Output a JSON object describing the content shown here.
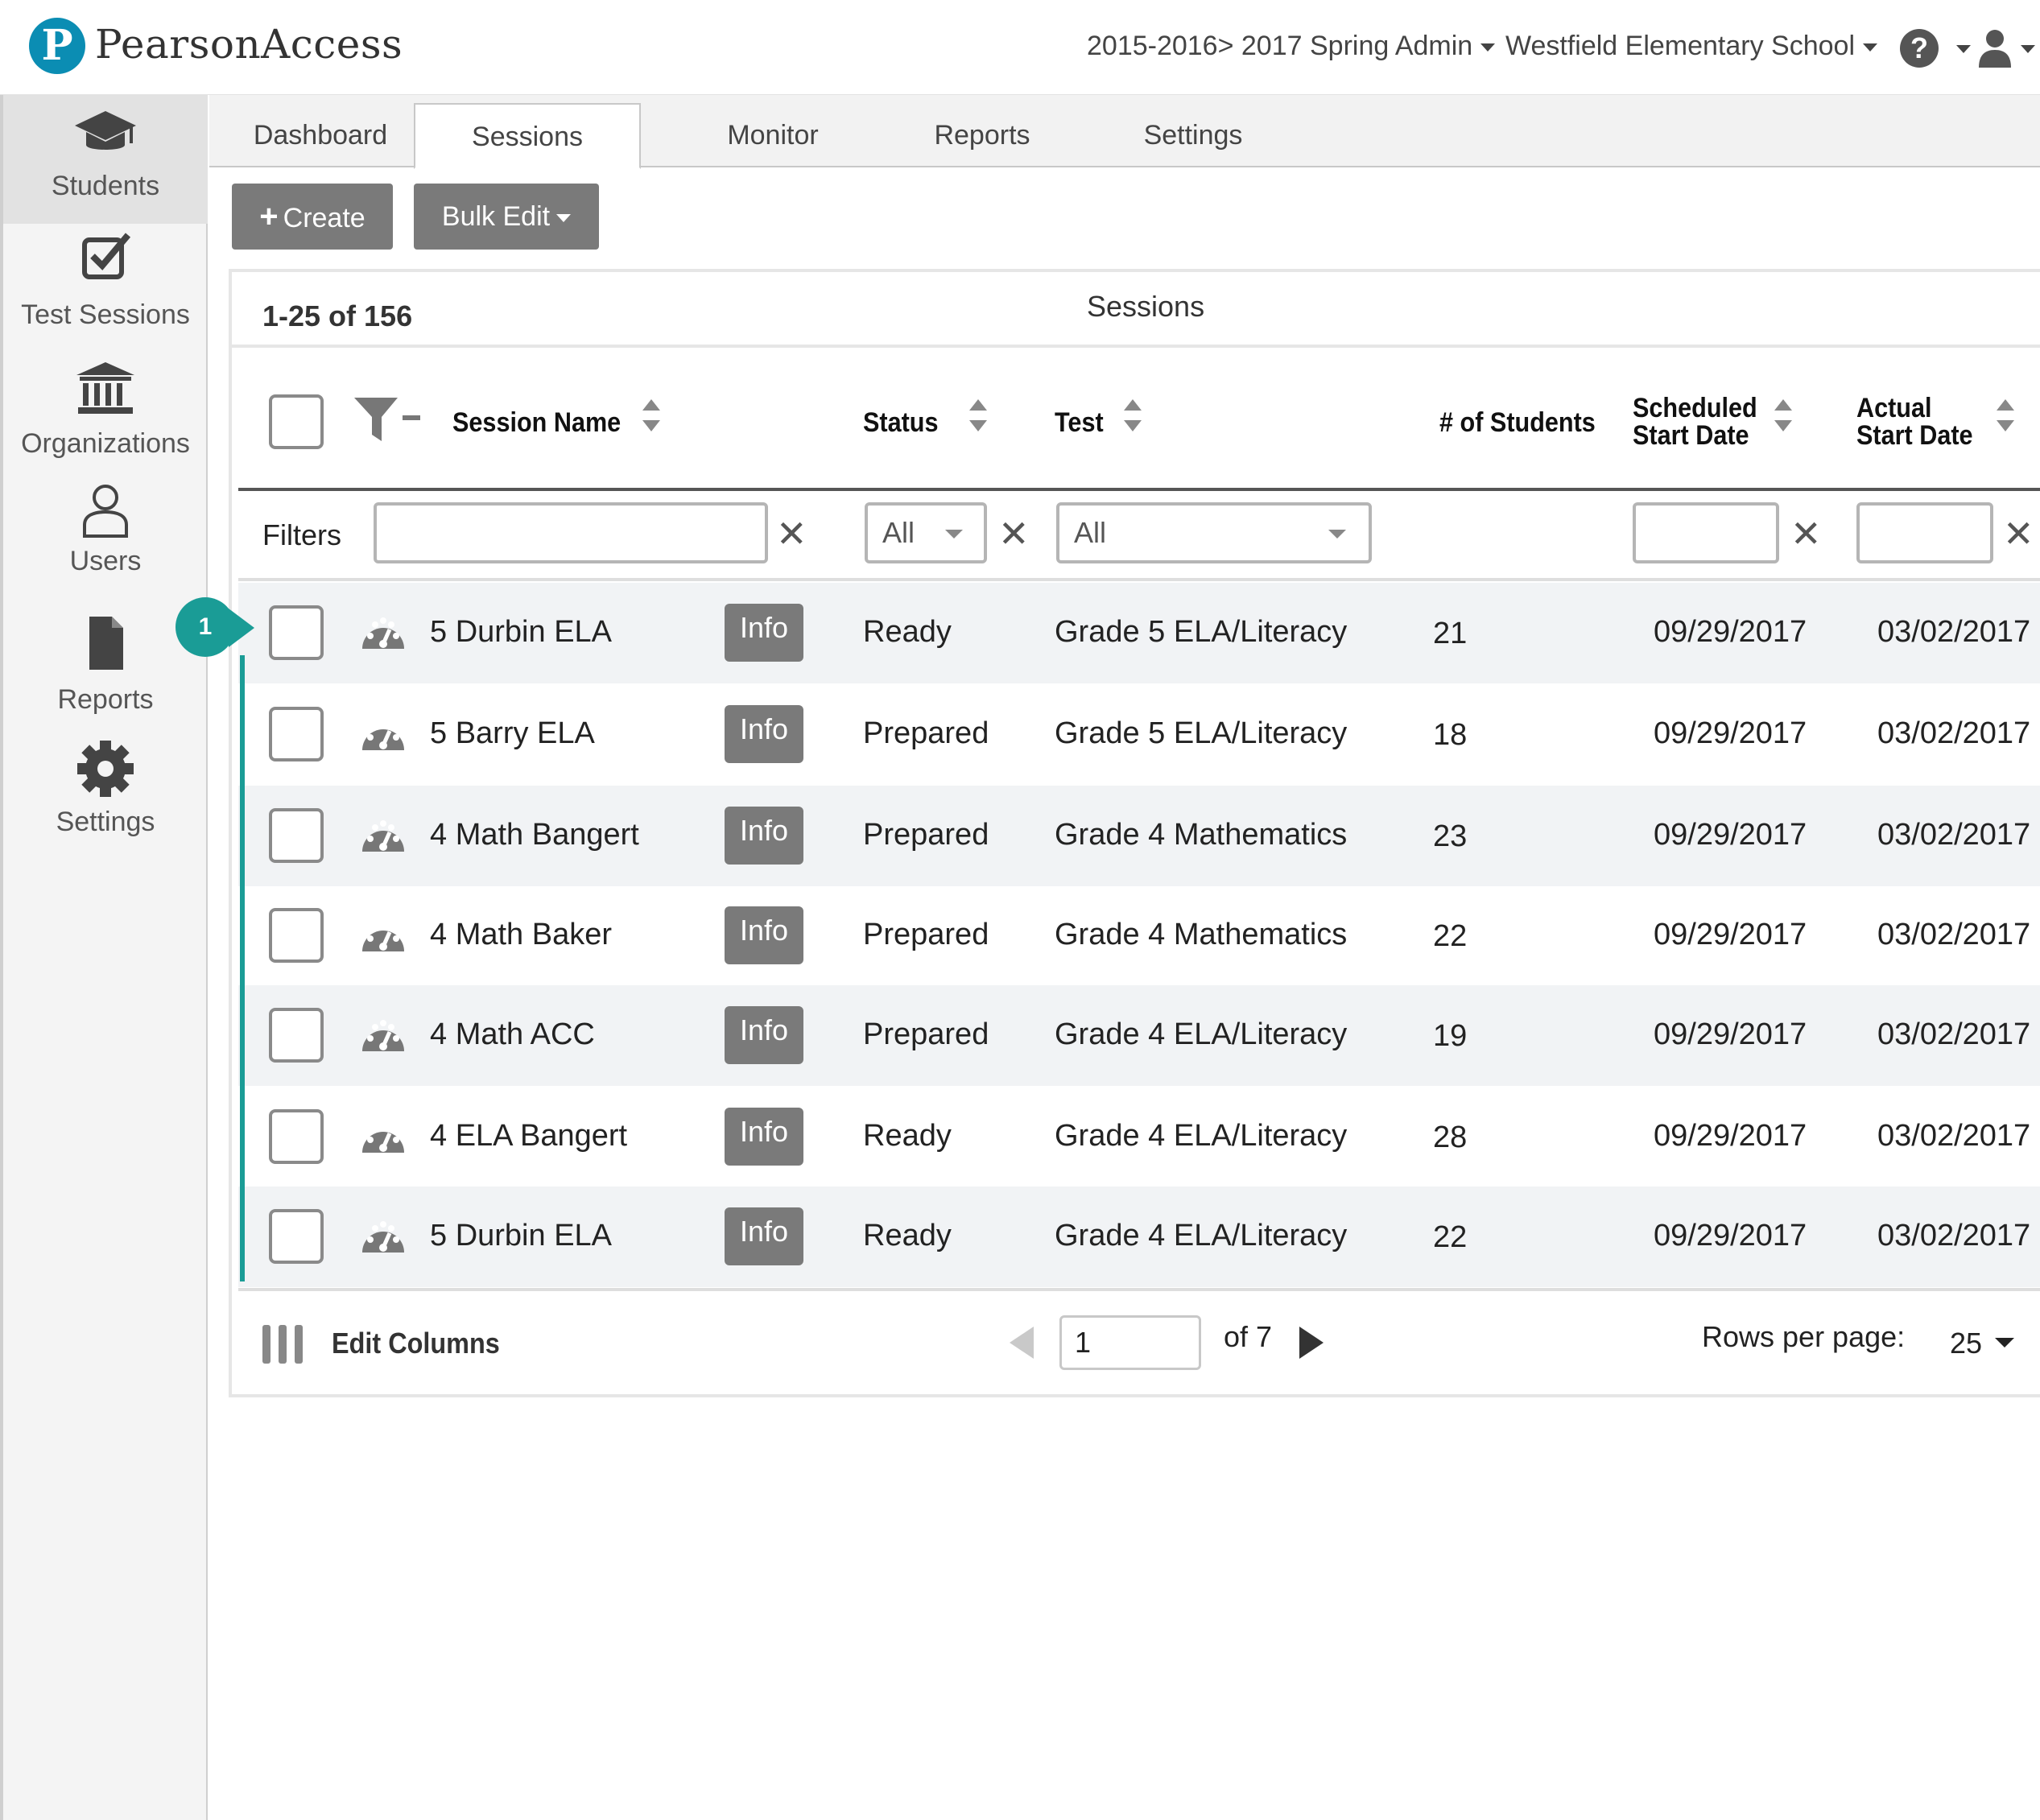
{
  "app": {
    "brand": "PearsonAccess",
    "logo_letter": "P",
    "admin_selector": "2015-2016> 2017 Spring Admin",
    "school_selector": "Westfield Elementary School",
    "help_symbol": "?"
  },
  "sidebar": {
    "items": [
      {
        "label": "Students",
        "icon": "graduation-cap-icon",
        "active": true
      },
      {
        "label": "Test Sessions",
        "icon": "checkbox-check-icon",
        "active": false
      },
      {
        "label": "Organizations",
        "icon": "institution-icon",
        "active": false
      },
      {
        "label": "Users",
        "icon": "user-outline-icon",
        "active": false
      },
      {
        "label": "Reports",
        "icon": "document-icon",
        "active": false
      },
      {
        "label": "Settings",
        "icon": "gear-icon",
        "active": false
      }
    ]
  },
  "tabs": [
    {
      "label": "Dashboard",
      "active": false
    },
    {
      "label": "Sessions",
      "active": true
    },
    {
      "label": "Monitor",
      "active": false
    },
    {
      "label": "Reports",
      "active": false
    },
    {
      "label": "Settings",
      "active": false
    }
  ],
  "toolbar": {
    "create_symbol": "+",
    "create_label": "Create",
    "bulk_edit_label": "Bulk Edit"
  },
  "table": {
    "count_text": "1-25 of 156",
    "title": "Sessions",
    "headers": {
      "session_name": "Session Name",
      "status": "Status",
      "test": "Test",
      "students": "# of Students",
      "scheduled_line1": "Scheduled",
      "scheduled_line2": "Start Date",
      "actual_line1": "Actual",
      "actual_line2": "Start Date"
    },
    "filters": {
      "label": "Filters",
      "session_name_value": "",
      "status_value": "All",
      "test_value": "All",
      "scheduled_value": "",
      "actual_value": "",
      "clear_symbol": "✕"
    },
    "info_label": "Info",
    "rows": [
      {
        "name": "5 Durbin ELA",
        "status": "Ready",
        "test": "Grade 5 ELA/Literacy",
        "students": "21",
        "scheduled": "09/29/2017",
        "actual": "03/02/2017"
      },
      {
        "name": "5 Barry ELA",
        "status": "Prepared",
        "test": "Grade 5 ELA/Literacy",
        "students": "18",
        "scheduled": "09/29/2017",
        "actual": "03/02/2017"
      },
      {
        "name": "4 Math Bangert",
        "status": "Prepared",
        "test": "Grade 4 Mathematics",
        "students": "23",
        "scheduled": "09/29/2017",
        "actual": "03/02/2017"
      },
      {
        "name": "4 Math Baker",
        "status": "Prepared",
        "test": "Grade 4 Mathematics",
        "students": "22",
        "scheduled": "09/29/2017",
        "actual": "03/02/2017"
      },
      {
        "name": "4 Math ACC",
        "status": "Prepared",
        "test": "Grade 4 ELA/Literacy",
        "students": "19",
        "scheduled": "09/29/2017",
        "actual": "03/02/2017"
      },
      {
        "name": "4 ELA Bangert",
        "status": "Ready",
        "test": "Grade 4 ELA/Literacy",
        "students": "28",
        "scheduled": "09/29/2017",
        "actual": "03/02/2017"
      },
      {
        "name": "5 Durbin ELA",
        "status": "Ready",
        "test": "Grade 4 ELA/Literacy",
        "students": "22",
        "scheduled": "09/29/2017",
        "actual": "03/02/2017"
      }
    ]
  },
  "footer": {
    "edit_columns": "Edit Columns",
    "page_value": "1",
    "page_of": "of 7",
    "rows_per_page_label": "Rows per page:",
    "rows_per_page_value": "25"
  },
  "callout": {
    "number": "1"
  },
  "colors": {
    "accent": "#1a9c96",
    "brand": "#0b8db3",
    "button": "#7a7a7a"
  }
}
